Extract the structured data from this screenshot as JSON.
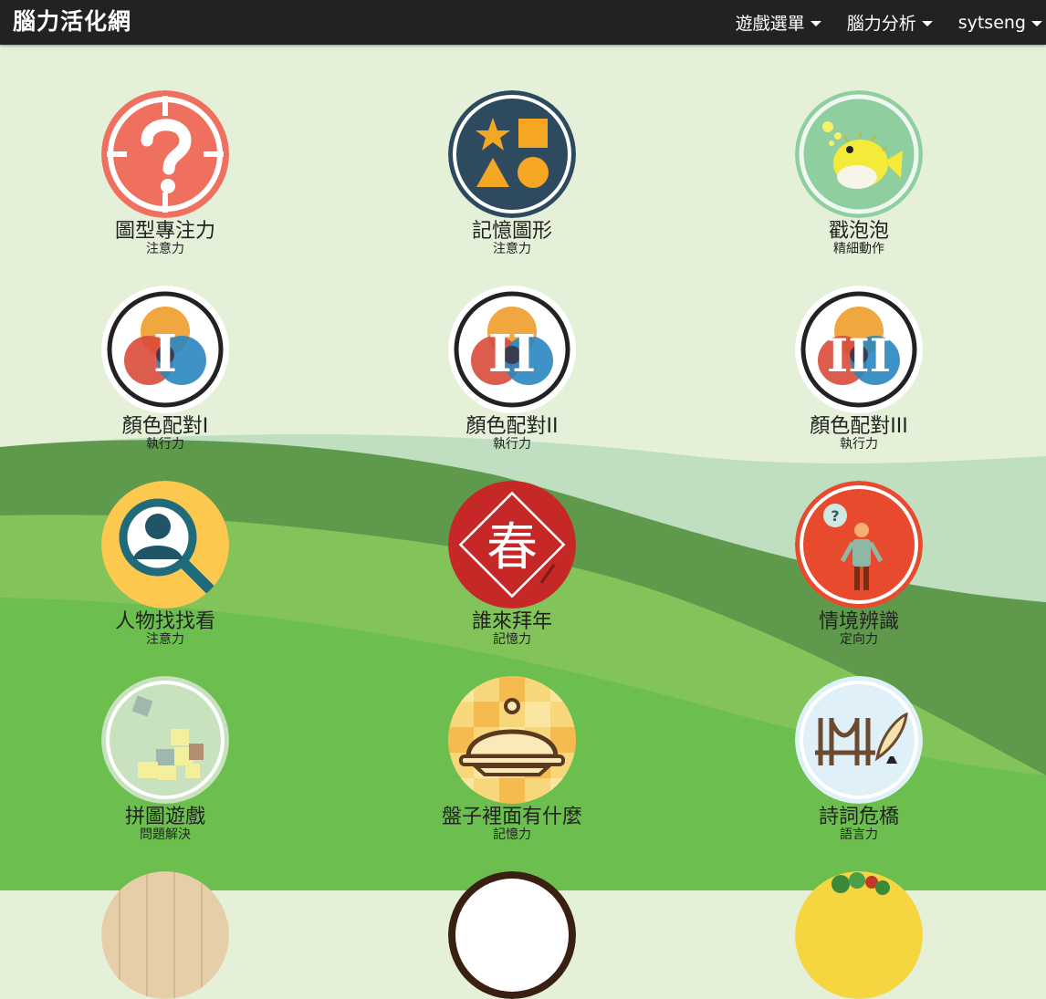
{
  "navbar": {
    "brand": "腦力活化網",
    "menu": [
      {
        "label": "遊戲選單"
      },
      {
        "label": "腦力分析"
      },
      {
        "label": "sytseng"
      }
    ]
  },
  "games": [
    {
      "title": "圖型專注力",
      "category": "注意力",
      "icon": "question-target-icon"
    },
    {
      "title": "記憶圖形",
      "category": "注意力",
      "icon": "shapes-icon"
    },
    {
      "title": "戳泡泡",
      "category": "精細動作",
      "icon": "pufferfish-icon"
    },
    {
      "title": "顏色配對I",
      "category": "執行力",
      "icon": "color-match-1-icon",
      "numeral": "I"
    },
    {
      "title": "顏色配對II",
      "category": "執行力",
      "icon": "color-match-2-icon",
      "numeral": "II"
    },
    {
      "title": "顏色配對III",
      "category": "執行力",
      "icon": "color-match-3-icon",
      "numeral": "III"
    },
    {
      "title": "人物找找看",
      "category": "注意力",
      "icon": "magnifier-person-icon"
    },
    {
      "title": "誰來拜年",
      "category": "記憶力",
      "icon": "spring-couplet-icon",
      "glyph": "春"
    },
    {
      "title": "情境辨識",
      "category": "定向力",
      "icon": "confused-person-icon"
    },
    {
      "title": "拼圖遊戲",
      "category": "問題解決",
      "icon": "puzzle-icon"
    },
    {
      "title": "盤子裡面有什麼",
      "category": "記憶力",
      "icon": "cloche-icon"
    },
    {
      "title": "詩詞危橋",
      "category": "語言力",
      "icon": "bridge-quill-icon"
    }
  ]
}
